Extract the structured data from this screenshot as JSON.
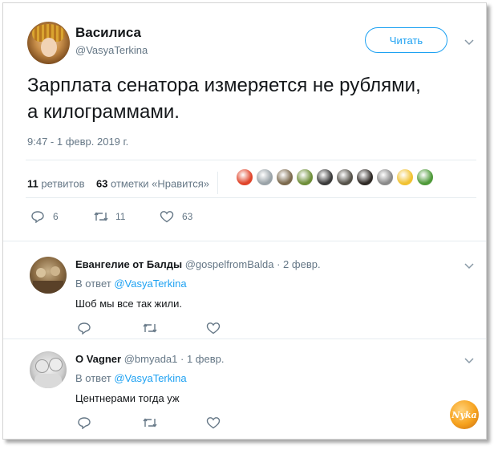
{
  "tweet": {
    "author_name": "Василиса",
    "author_handle": "@VasyaTerkina",
    "follow_label": "Читать",
    "text_line1": "Зарплата сенатора измеряется не рублями,",
    "text_line2": "а килограммами.",
    "time": "9:47 - 1 февр. 2019 г.",
    "retweets_count": "11",
    "retweets_label": "ретвитов",
    "likes_count": "63",
    "likes_label": "отметки «Нравится»",
    "likers_avatar_colors": [
      "#e0452b",
      "#9aa3a8",
      "#7c6a4e",
      "#6f8f3a",
      "#3b3b3b",
      "#55524a",
      "#2f2a26",
      "#8a8a8a",
      "#f1c232",
      "#4f9a3a"
    ],
    "actions": {
      "replies": "6",
      "retweets": "11",
      "likes": "63"
    }
  },
  "replies": [
    {
      "name": "Евангелие от Балды",
      "handle": "@gospelfromBalda",
      "date": "· 2 февр.",
      "reply_prefix": "В ответ",
      "reply_to": "@VasyaTerkina",
      "text": "Шоб мы все так жили."
    },
    {
      "name": "O Vagner",
      "handle": "@bmyada1",
      "date": "· 1 февр.",
      "reply_prefix": "В ответ",
      "reply_to": "@VasyaTerkina",
      "text": "Центнерами тогда уж"
    }
  ],
  "watermark": "Nyka",
  "colors": {
    "accent": "#1da1f2",
    "text": "#14171a",
    "muted": "#657786",
    "divider": "#e6ecf0"
  }
}
